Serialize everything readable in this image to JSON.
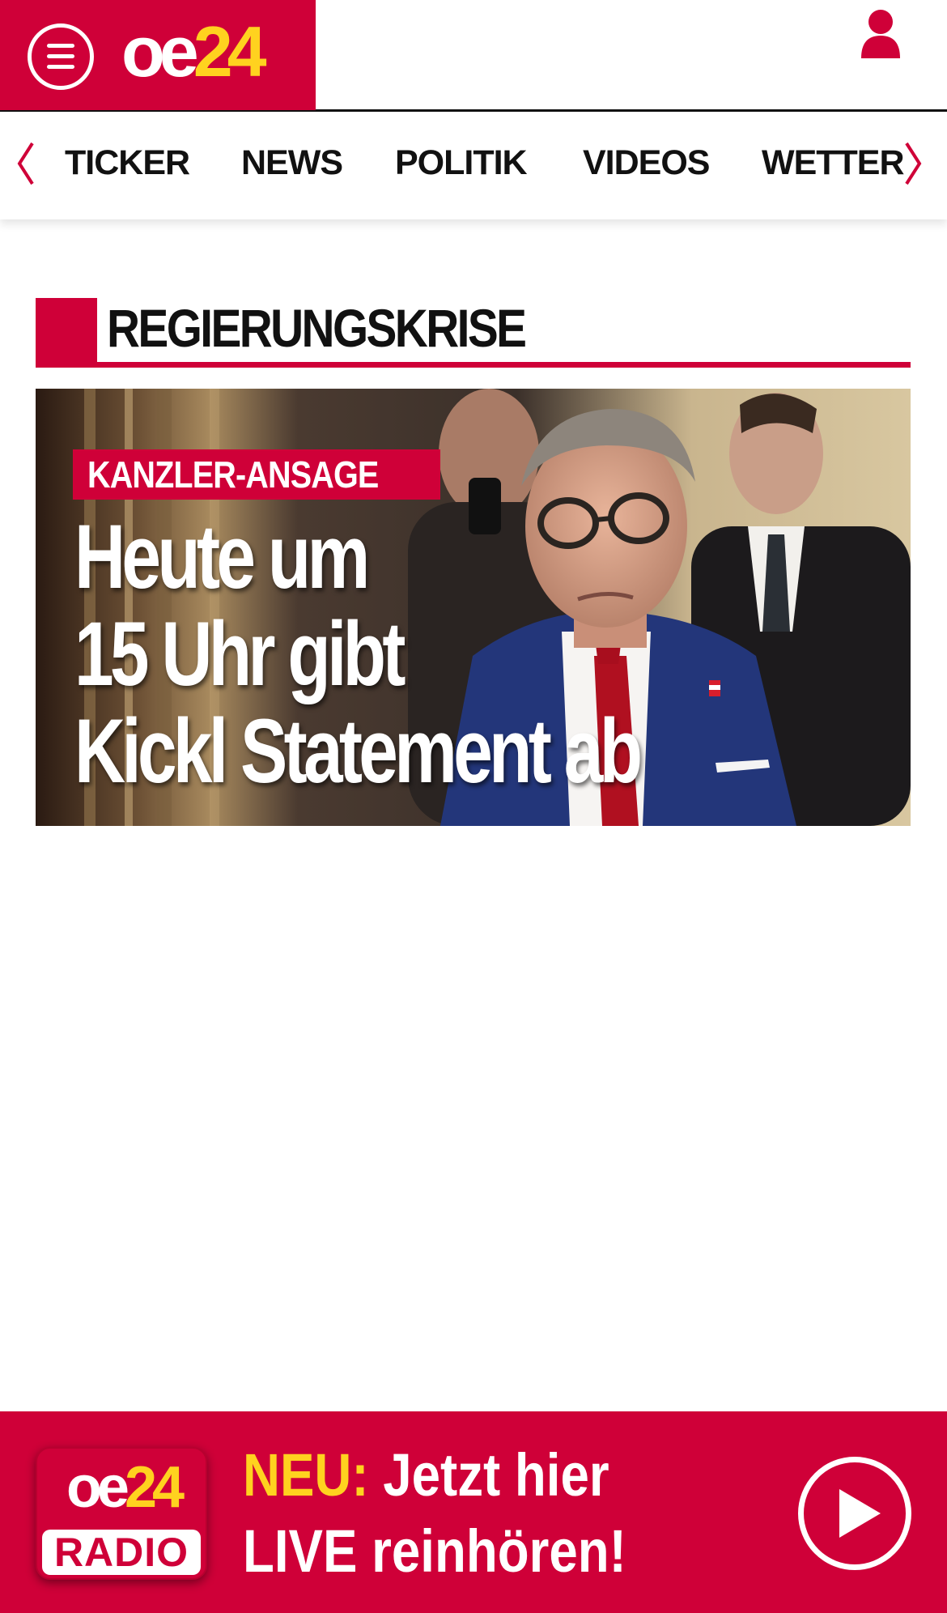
{
  "header": {
    "logo": {
      "part1": "oe",
      "part2": "24"
    },
    "menu_icon": "hamburger-menu-icon",
    "user_icon": "user-account-icon"
  },
  "nav": {
    "left_arrow_icon": "chevron-left-icon",
    "right_arrow_icon": "chevron-right-icon",
    "items": [
      {
        "label": "TICKER"
      },
      {
        "label": "NEWS"
      },
      {
        "label": "POLITIK"
      },
      {
        "label": "VIDEOS"
      },
      {
        "label": "WETTER"
      }
    ]
  },
  "section": {
    "title": "REGIERUNGSKRISE"
  },
  "teaser": {
    "kicker": "KANZLER-ANSAGE",
    "headline_lines": [
      "Heute um",
      "15 Uhr gibt",
      "Kickl Statement ab"
    ]
  },
  "radio_banner": {
    "logo_top_part1": "oe",
    "logo_top_part2": "24",
    "logo_bottom": "RADIO",
    "highlight": "NEU:",
    "line1_rest": " Jetzt hier",
    "line2": "LIVE reinhören!",
    "play_icon": "play-icon"
  },
  "colors": {
    "brand_red": "#cf0038",
    "brand_yellow": "#ffd21f",
    "text_dark": "#111111",
    "background": "#ffffff"
  }
}
